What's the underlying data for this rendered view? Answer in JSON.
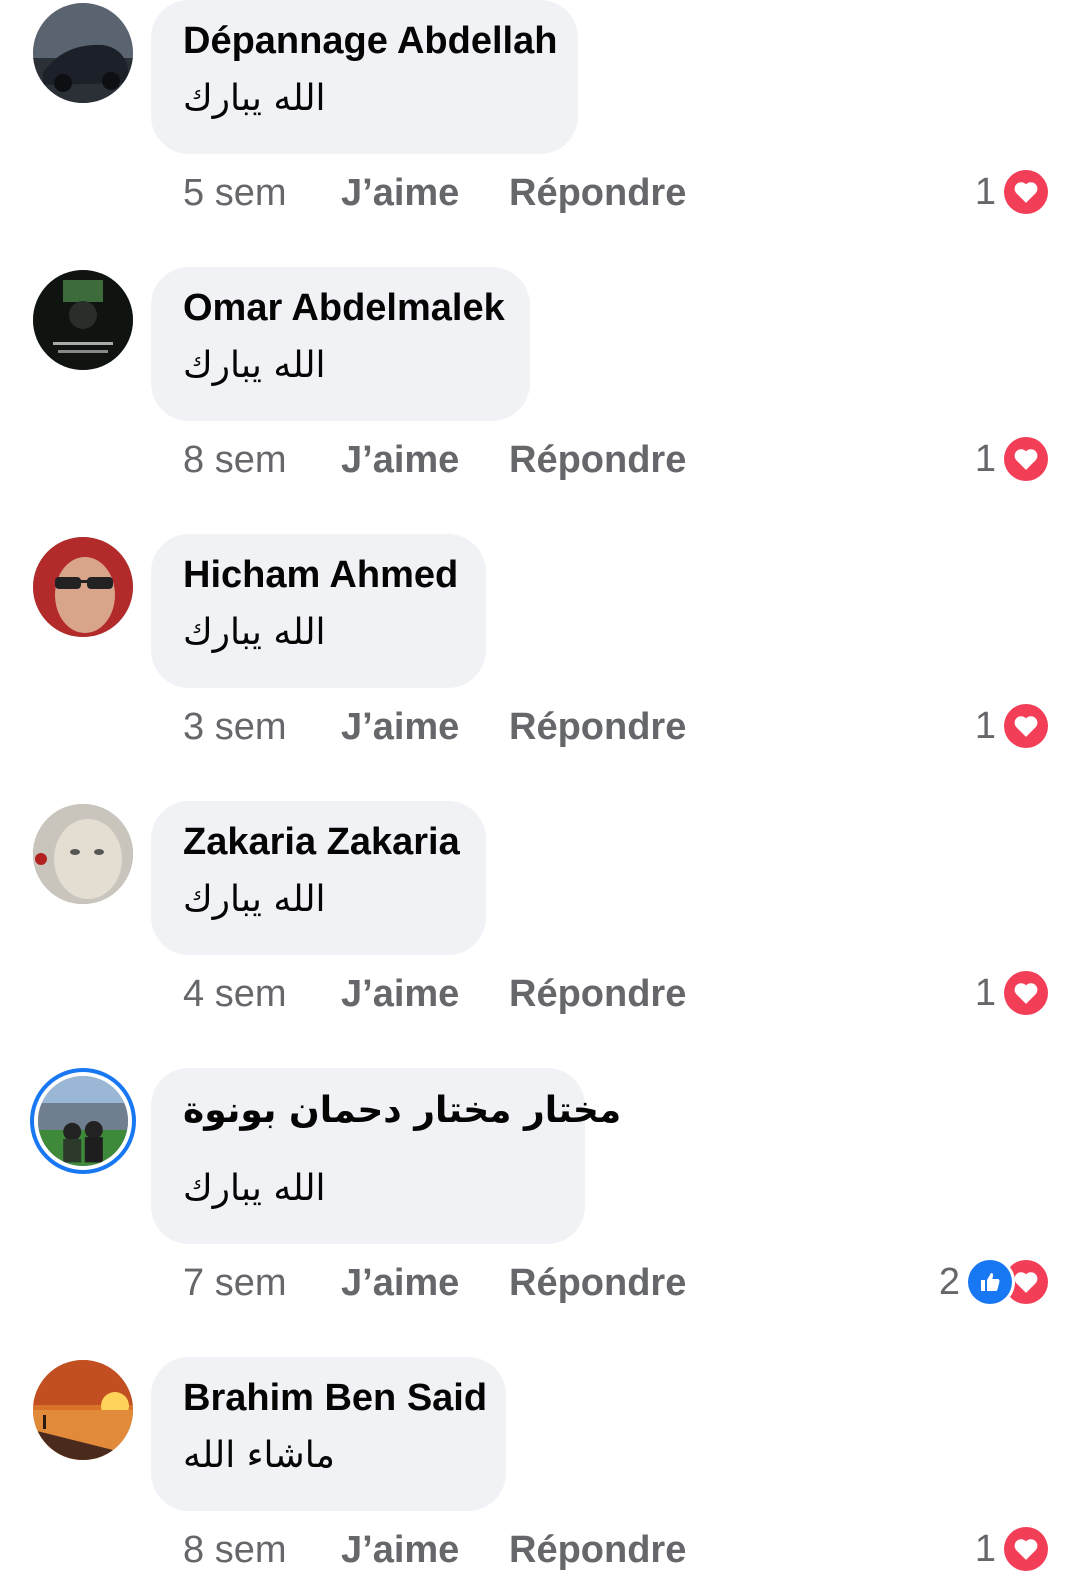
{
  "colors": {
    "accent": "#1877f2",
    "heart": "#f33e58",
    "bubble": "#f0f2f5",
    "muted": "#65676b"
  },
  "comments": [
    {
      "name": "Dépannage Abdellah",
      "text": "الله يبارك",
      "time": "5 sem",
      "like_label": "J’aime",
      "reply_label": "Répondre",
      "reaction_count": "1",
      "reactions": [
        "heart-icon"
      ]
    },
    {
      "name": "Omar Abdelmalek",
      "text": "الله يبارك",
      "time": "8 sem",
      "like_label": "J’aime",
      "reply_label": "Répondre",
      "reaction_count": "1",
      "reactions": [
        "heart-icon"
      ]
    },
    {
      "name": "Hicham Ahmed",
      "text": "الله يبارك",
      "time": "3 sem",
      "like_label": "J’aime",
      "reply_label": "Répondre",
      "reaction_count": "1",
      "reactions": [
        "heart-icon"
      ]
    },
    {
      "name": "Zakaria Zakaria",
      "text": "الله يبارك",
      "time": "4 sem",
      "like_label": "J’aime",
      "reply_label": "Répondre",
      "reaction_count": "1",
      "reactions": [
        "heart-icon"
      ]
    },
    {
      "name": "مختار مختار دحمان بونوة",
      "text": "الله يبارك",
      "time": "7 sem",
      "like_label": "J’aime",
      "reply_label": "Répondre",
      "reaction_count": "2",
      "reactions": [
        "like-icon",
        "heart-icon"
      ]
    },
    {
      "name": "Brahim Ben Said",
      "text": "ماشاء الله",
      "time": "8 sem",
      "like_label": "J’aime",
      "reply_label": "Répondre",
      "reaction_count": "1",
      "reactions": [
        "heart-icon"
      ]
    }
  ]
}
